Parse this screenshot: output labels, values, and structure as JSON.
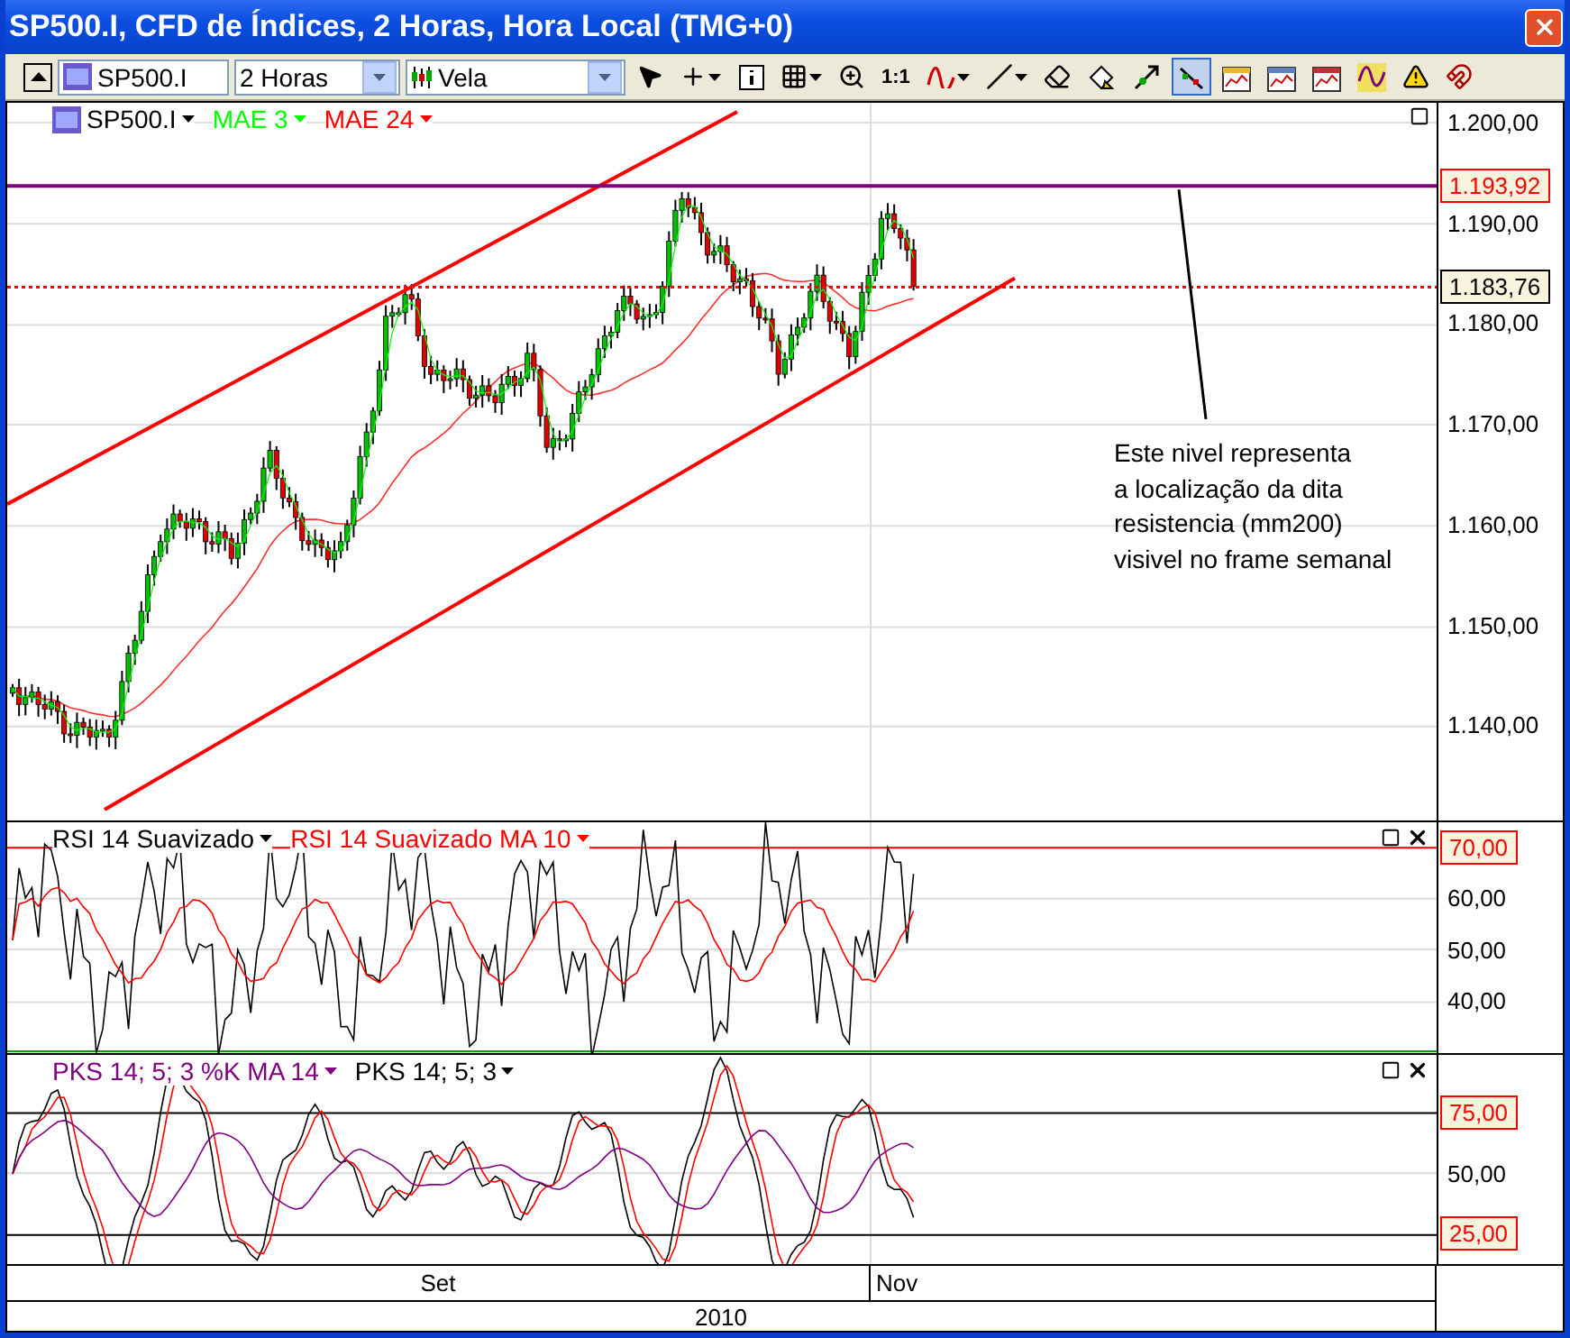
{
  "window": {
    "title": "SP500.I, CFD de Índices, 2 Horas, Hora Local (TMG+0)"
  },
  "toolbar": {
    "symbol": "SP500.I",
    "timeframe": "2 Horas",
    "chart_type": "Vela",
    "tools": [
      {
        "selected": false
      },
      {
        "selected": false
      },
      {
        "selected": false
      },
      {
        "selected": false
      },
      {
        "selected": false
      },
      {
        "selected": false,
        "label": "1:1"
      },
      {
        "selected": false
      },
      {
        "selected": false
      },
      {
        "selected": false
      },
      {
        "selected": false
      },
      {
        "selected": false
      },
      {
        "selected": true
      },
      {
        "selected": false
      },
      {
        "selected": false
      },
      {
        "selected": false
      },
      {
        "selected": false
      },
      {
        "selected": false
      },
      {
        "selected": false
      }
    ]
  },
  "price_panel": {
    "legend": [
      {
        "label": "SP500.I",
        "color": "#000000"
      },
      {
        "label": "MAE 3",
        "color": "#00ff00"
      },
      {
        "label": "MAE 24",
        "color": "#ff0000"
      }
    ],
    "axis_labels": [
      "1.200,00",
      "1.190,00",
      "1.180,00",
      "1.170,00",
      "1.160,00",
      "1.150,00",
      "1.140,00"
    ],
    "price_badges": [
      {
        "text": "1.193,92",
        "color": "#ff0000"
      },
      {
        "text": "1.183,76",
        "color": "#000000"
      }
    ],
    "annotation": [
      "Este nivel representa",
      "a localização da dita",
      "resistencia (mm200)",
      "visivel no frame semanal"
    ]
  },
  "rsi_panel": {
    "legend": [
      {
        "label": "RSI 14 Suavizado",
        "color": "#000000"
      },
      {
        "label": "RSI 14 Suavizado MA 10",
        "color": "#ff0000"
      }
    ],
    "axis_labels": [
      "70,00",
      "60,00",
      "50,00",
      "40,00"
    ]
  },
  "pks_panel": {
    "legend": [
      {
        "label": "PKS 14; 5; 3 %K MA 14",
        "color": "#800080"
      },
      {
        "label": "PKS 14; 5; 3",
        "color": "#000000"
      }
    ],
    "axis_labels": [
      "75,00",
      "50,00",
      "25,00"
    ]
  },
  "time_axis": {
    "months": [
      "Set",
      "Nov"
    ],
    "year": "2010"
  }
}
